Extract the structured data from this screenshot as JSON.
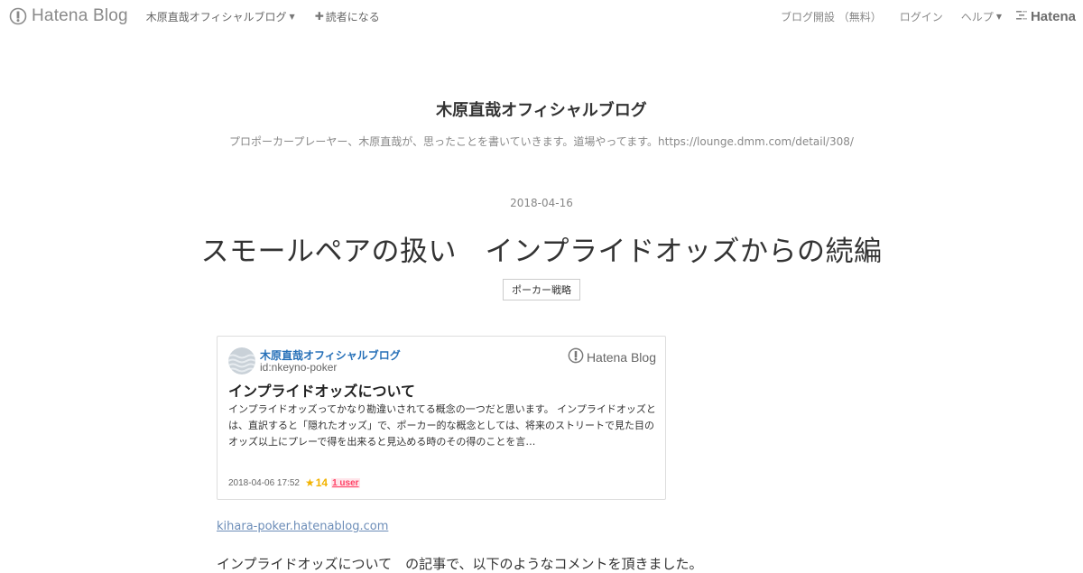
{
  "globalheader": {
    "logo_text": "Hatena Blog",
    "blog_name": "木原直哉オフィシャルブログ",
    "subscribe_label": "読者になる",
    "links": {
      "signup": "ブログ開設 （無料）",
      "login": "ログイン",
      "help": "ヘルプ"
    },
    "hatena_text": "Hatena"
  },
  "blog": {
    "title": "木原直哉オフィシャルブログ",
    "description": "プロポーカープレーヤー、木原直哉が、思ったことを書いていきます。道場やってます。https://lounge.dmm.com/detail/308/"
  },
  "entry": {
    "date": "2018-04-16",
    "title": "スモールペアの扱い　インプライドオッズからの続編",
    "category": "ポーカー戦略"
  },
  "embed": {
    "blog_name": "木原直哉オフィシャルブログ",
    "user_id": "id:nkeyno-poker",
    "service_logo_text": "Hatena Blog",
    "title": "インプライドオッズについて",
    "excerpt": "インプライドオッズってかなり勘違いされてる概念の一つだと思います。 インプライドオッズとは、直訳すると「隠れたオッズ」で、ポーカー的な概念としては、将来のストリートで見た目のオッズ以上にプレーで得を出来ると見込める時のその得のことを言…",
    "datetime": "2018-04-06 17:52",
    "star_count": "14",
    "users_label": "1 user"
  },
  "source_link": "kihara-poker.hatenablog.com",
  "body": {
    "first_line": "インプライドオッズについて　の記事で、以下のようなコメントを頂きました。"
  },
  "colors": {
    "link_blue": "#2670b8",
    "star_yellow": "#f2b300",
    "bookmark_red": "#ff4166",
    "muted_text": "#888888"
  }
}
